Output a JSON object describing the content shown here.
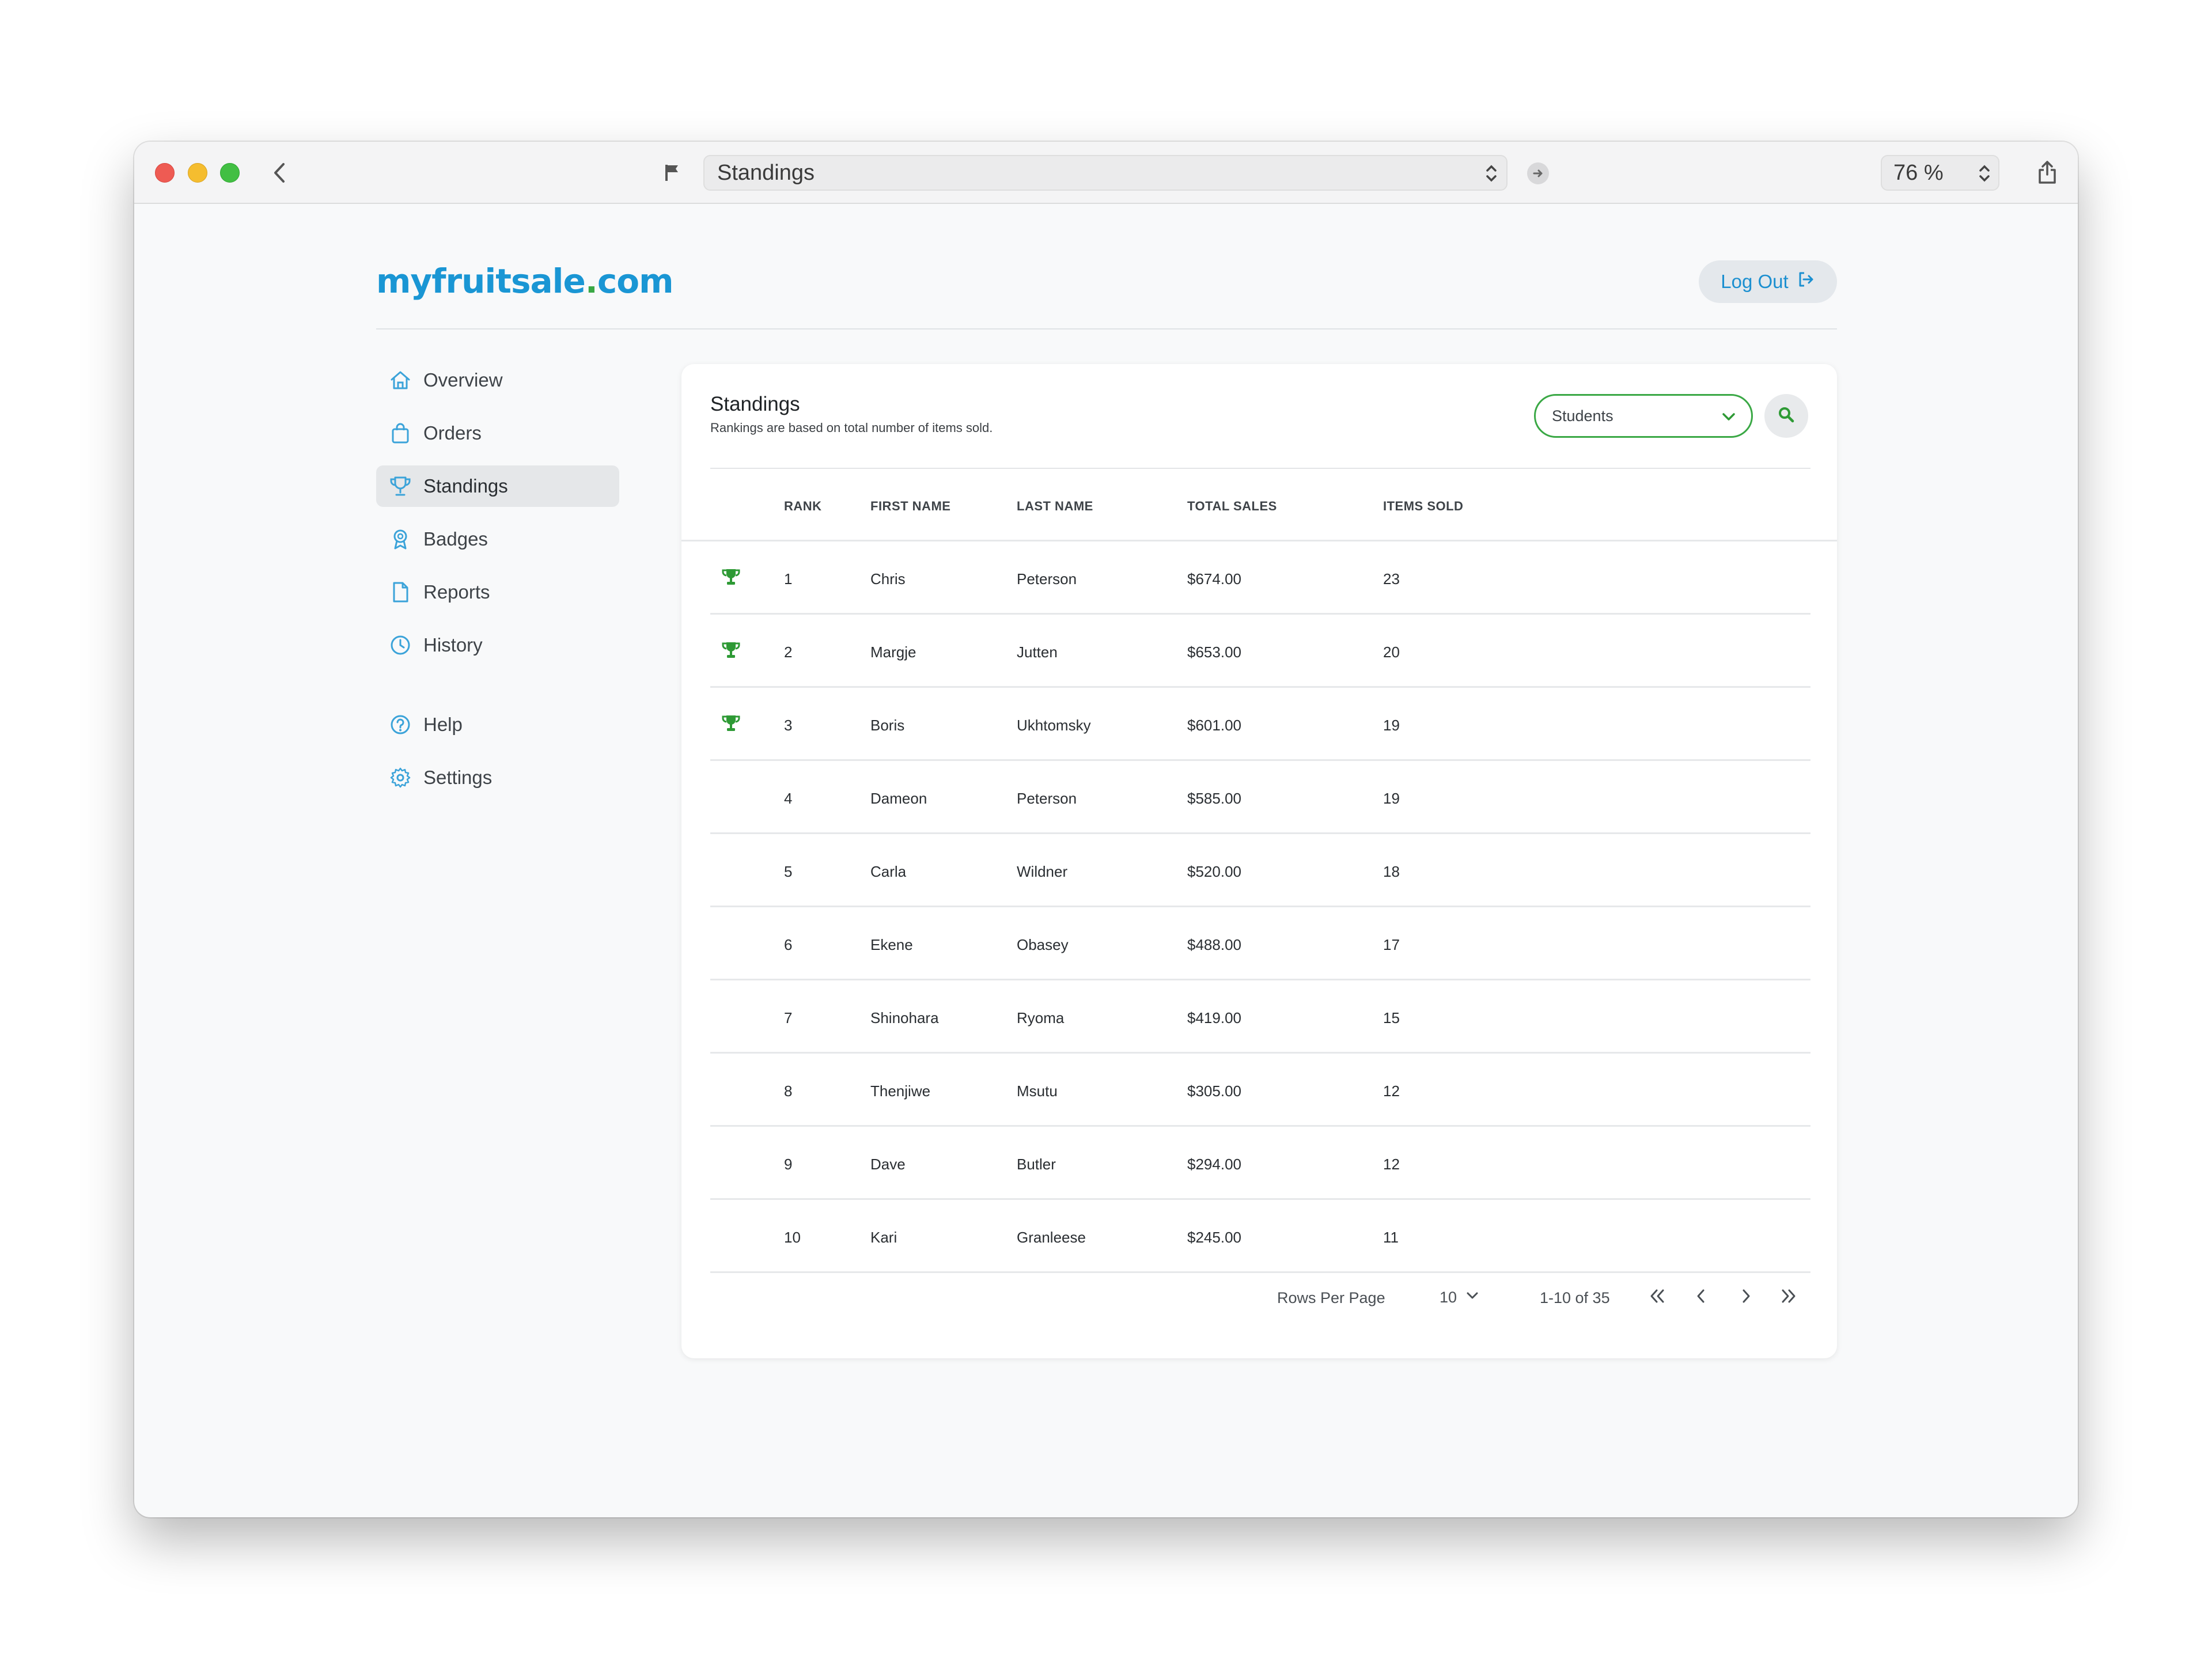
{
  "browser": {
    "url_title": "Standings",
    "zoom": "76 %"
  },
  "header": {
    "logo_main": "myfruitsale",
    "logo_dot": ".",
    "logo_tld": "com",
    "logout_label": "Log Out"
  },
  "sidebar": {
    "items": [
      {
        "label": "Overview",
        "icon": "home-icon"
      },
      {
        "label": "Orders",
        "icon": "shopping-bag-icon"
      },
      {
        "label": "Standings",
        "icon": "trophy-icon",
        "active": true
      },
      {
        "label": "Badges",
        "icon": "badge-icon"
      },
      {
        "label": "Reports",
        "icon": "document-icon"
      },
      {
        "label": "History",
        "icon": "clock-icon"
      },
      {
        "label": "Help",
        "icon": "help-circle-icon"
      },
      {
        "label": "Settings",
        "icon": "gear-icon"
      }
    ]
  },
  "standings": {
    "title": "Standings",
    "subtitle": "Rankings are based on total number of items sold.",
    "filter_value": "Students",
    "columns": {
      "rank": "RANK",
      "first_name": "FIRST NAME",
      "last_name": "LAST NAME",
      "total_sales": "TOTAL SALES",
      "items_sold": "ITEMS SOLD"
    },
    "rows": [
      {
        "rank": "1",
        "first": "Chris",
        "last": "Peterson",
        "sales": "$674.00",
        "items": "23",
        "trophy": true
      },
      {
        "rank": "2",
        "first": "Margje",
        "last": "Jutten",
        "sales": "$653.00",
        "items": "20",
        "trophy": true
      },
      {
        "rank": "3",
        "first": "Boris",
        "last": "Ukhtomsky",
        "sales": "$601.00",
        "items": "19",
        "trophy": true
      },
      {
        "rank": "4",
        "first": "Dameon",
        "last": "Peterson",
        "sales": "$585.00",
        "items": "19",
        "trophy": false
      },
      {
        "rank": "5",
        "first": "Carla",
        "last": "Wildner",
        "sales": "$520.00",
        "items": "18",
        "trophy": false
      },
      {
        "rank": "6",
        "first": "Ekene",
        "last": "Obasey",
        "sales": "$488.00",
        "items": "17",
        "trophy": false
      },
      {
        "rank": "7",
        "first": "Shinohara",
        "last": "Ryoma",
        "sales": "$419.00",
        "items": "15",
        "trophy": false
      },
      {
        "rank": "8",
        "first": "Thenjiwe",
        "last": "Msutu",
        "sales": "$305.00",
        "items": "12",
        "trophy": false
      },
      {
        "rank": "9",
        "first": "Dave",
        "last": "Butler",
        "sales": "$294.00",
        "items": "12",
        "trophy": false
      },
      {
        "rank": "10",
        "first": "Kari",
        "last": "Granleese",
        "sales": "$245.00",
        "items": "11",
        "trophy": false
      }
    ],
    "pagination": {
      "rows_per_page_label": "Rows Per Page",
      "rows_per_page_value": "10",
      "range": "1-10 of 35"
    }
  },
  "colors": {
    "brand_blue": "#1a96d4",
    "brand_green": "#3aa845",
    "trophy_green": "#2e9a35"
  }
}
